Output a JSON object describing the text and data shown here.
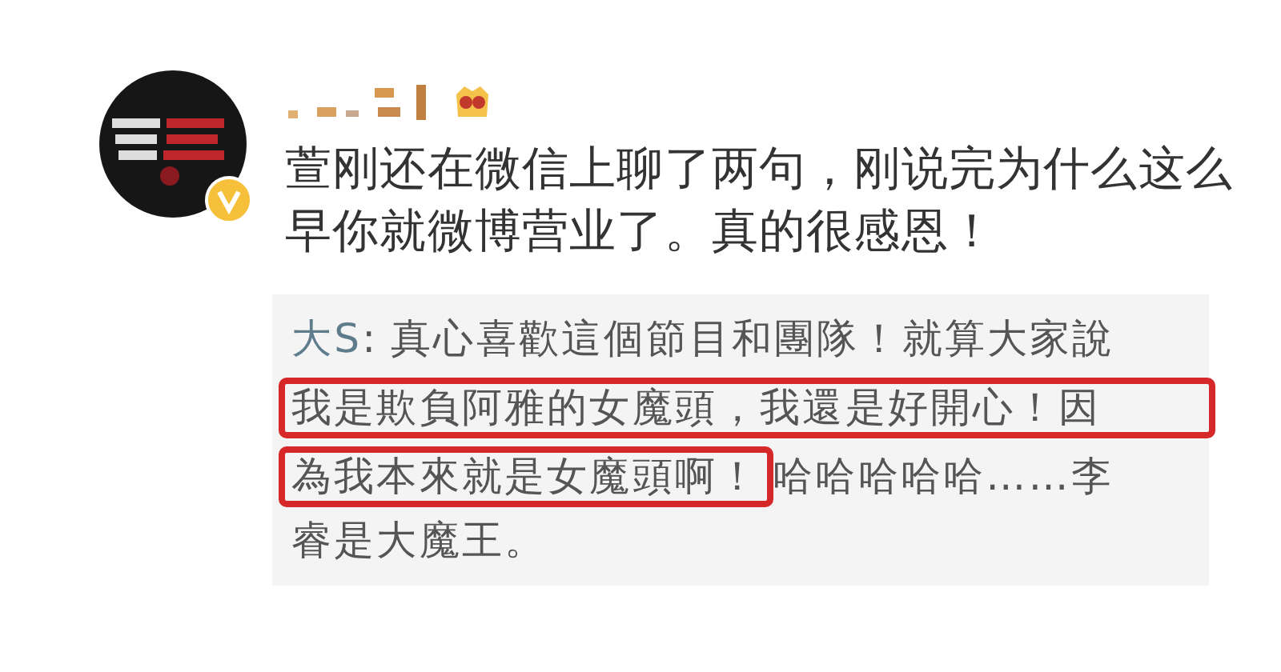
{
  "post": {
    "verified": true,
    "text": "萱刚还在微信上聊了两句，刚说完为什么这么早你就微博营业了。真的很感恩！"
  },
  "quote": {
    "author": "大S",
    "separator": ":",
    "segments": [
      {
        "text": "真心喜歡這個節目和團隊！就算大家說",
        "highlighted": false
      },
      {
        "text": "我是欺負阿雅的女魔頭，我還是好開心！因",
        "highlighted": true
      },
      {
        "text": "為我本來就是女魔頭啊！",
        "highlighted": true
      },
      {
        "text": "哈哈哈哈哈……李",
        "highlighted": false
      },
      {
        "text": "睿是大魔王。",
        "highlighted": false
      }
    ]
  }
}
